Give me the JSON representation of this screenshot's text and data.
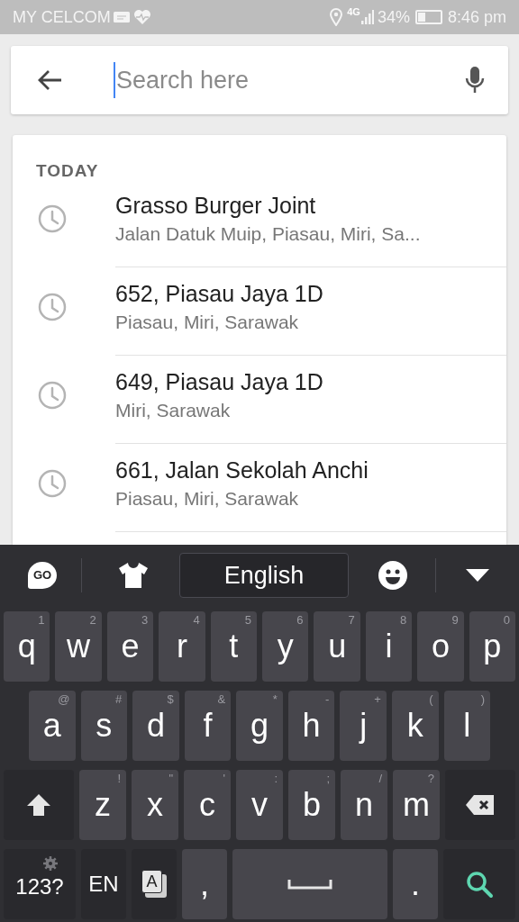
{
  "status_bar": {
    "carrier": "MY CELCOM",
    "network": "4G",
    "battery": "34%",
    "time": "8:46 pm"
  },
  "search": {
    "placeholder": "Search here"
  },
  "history": {
    "heading": "TODAY",
    "items": [
      {
        "title": "Grasso Burger Joint",
        "subtitle": "Jalan Datuk Muip, Piasau, Miri, Sa..."
      },
      {
        "title": "652, Piasau Jaya 1D",
        "subtitle": "Piasau, Miri, Sarawak"
      },
      {
        "title": "649, Piasau Jaya 1D",
        "subtitle": "Miri, Sarawak"
      },
      {
        "title": "661, Jalan Sekolah Anchi",
        "subtitle": "Piasau, Miri, Sarawak"
      }
    ]
  },
  "keyboard": {
    "logo": "GO",
    "language": "English",
    "rows": [
      {
        "keys": [
          {
            "kind": "key",
            "label": "q",
            "hint": "1"
          },
          {
            "kind": "key",
            "label": "w",
            "hint": "2"
          },
          {
            "kind": "key",
            "label": "e",
            "hint": "3"
          },
          {
            "kind": "key",
            "label": "r",
            "hint": "4"
          },
          {
            "kind": "key",
            "label": "t",
            "hint": "5"
          },
          {
            "kind": "key",
            "label": "y",
            "hint": "6"
          },
          {
            "kind": "key",
            "label": "u",
            "hint": "7"
          },
          {
            "kind": "key",
            "label": "i",
            "hint": "8"
          },
          {
            "kind": "key",
            "label": "o",
            "hint": "9"
          },
          {
            "kind": "key",
            "label": "p",
            "hint": "0"
          }
        ]
      },
      {
        "keys": [
          {
            "kind": "key",
            "label": "a",
            "hint": "@"
          },
          {
            "kind": "key",
            "label": "s",
            "hint": "#"
          },
          {
            "kind": "key",
            "label": "d",
            "hint": "$"
          },
          {
            "kind": "key",
            "label": "f",
            "hint": "&"
          },
          {
            "kind": "key",
            "label": "g",
            "hint": "*"
          },
          {
            "kind": "key",
            "label": "h",
            "hint": "-"
          },
          {
            "kind": "key",
            "label": "j",
            "hint": "+"
          },
          {
            "kind": "key",
            "label": "k",
            "hint": "("
          },
          {
            "kind": "key",
            "label": "l",
            "hint": ")"
          }
        ]
      },
      {
        "keys": [
          {
            "kind": "shift"
          },
          {
            "kind": "key",
            "label": "z",
            "hint": "!"
          },
          {
            "kind": "key",
            "label": "x",
            "hint": "\""
          },
          {
            "kind": "key",
            "label": "c",
            "hint": "'"
          },
          {
            "kind": "key",
            "label": "v",
            "hint": ":"
          },
          {
            "kind": "key",
            "label": "b",
            "hint": ";"
          },
          {
            "kind": "key",
            "label": "n",
            "hint": "/"
          },
          {
            "kind": "key",
            "label": "m",
            "hint": "?"
          },
          {
            "kind": "backspace"
          }
        ]
      },
      {
        "keys": [
          {
            "kind": "symbols",
            "label": "123?"
          },
          {
            "kind": "lang",
            "label": "EN"
          },
          {
            "kind": "clipboard",
            "label": "A"
          },
          {
            "kind": "key",
            "label": ","
          },
          {
            "kind": "space"
          },
          {
            "kind": "key",
            "label": "."
          },
          {
            "kind": "search"
          }
        ]
      }
    ]
  }
}
